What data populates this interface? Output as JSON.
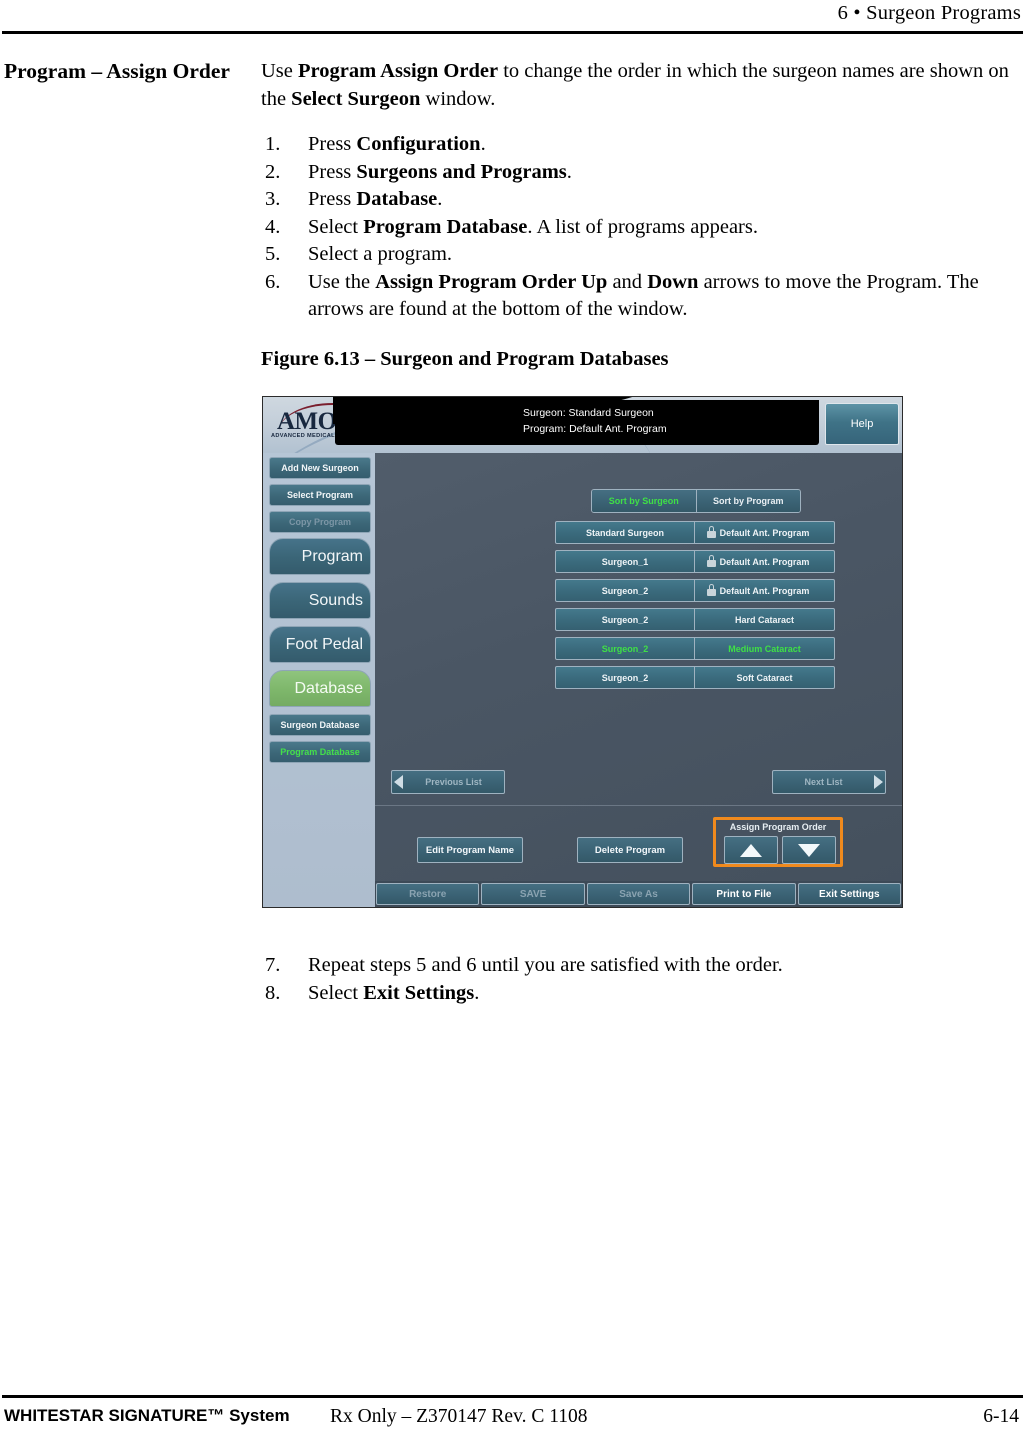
{
  "page_header": {
    "chapter": "6",
    "bullet": "•",
    "title": "Surgeon Programs",
    "full": "6  • Surgeon Programs"
  },
  "section": {
    "title": "Program – Assign Order"
  },
  "intro": {
    "part1": "Use ",
    "bold1": "Program Assign Order",
    "part2": " to change the order in which the surgeon names are shown on the ",
    "bold2": "Select Surgeon",
    "part3": " window."
  },
  "steps_before": [
    {
      "num": "1.",
      "pre": "Press ",
      "bold": "Configuration",
      "post": "."
    },
    {
      "num": "2.",
      "pre": "Press ",
      "bold": "Surgeons and Programs",
      "post": "."
    },
    {
      "num": "3.",
      "pre": "Press ",
      "bold": "Database",
      "post": "."
    },
    {
      "num": "4.",
      "pre": "Select ",
      "bold": "Program Database",
      "post": ". A list of programs appears."
    },
    {
      "num": "5.",
      "pre": "Select a program.",
      "bold": "",
      "post": ""
    },
    {
      "num": "6.",
      "pre": "Use the ",
      "bold": "Assign Program Order Up",
      "post": " and ",
      "bold2": "Down",
      "post2": " arrows to move the Program. The arrows are found at the bottom of the window."
    }
  ],
  "figure": {
    "caption": "Figure 6.13 – Surgeon and Program Databases",
    "logo": {
      "name": "AMO",
      "tagline": "ADVANCED MEDICAL OPTICS",
      "tm": "®"
    },
    "status": {
      "surgeon_line": "Surgeon:  Standard Surgeon",
      "program_line": "Program:  Default Ant. Program"
    },
    "help_label": "Help",
    "sidebar": [
      {
        "label": "Add New Surgeon",
        "state": "normal",
        "style": "small"
      },
      {
        "label": "Select Program",
        "state": "normal",
        "style": "small"
      },
      {
        "label": "Copy Program",
        "state": "disabled",
        "style": "small"
      },
      {
        "label": "Program",
        "state": "normal",
        "style": "big"
      },
      {
        "label": "Sounds",
        "state": "normal",
        "style": "big"
      },
      {
        "label": "Foot Pedal",
        "state": "normal",
        "style": "big"
      },
      {
        "label": "Database",
        "state": "active",
        "style": "big"
      },
      {
        "label": "Surgeon Database",
        "state": "normal",
        "style": "small"
      },
      {
        "label": "Program Database",
        "state": "selected",
        "style": "small"
      }
    ],
    "sort_tabs": [
      {
        "label": "Sort by Surgeon",
        "active": true
      },
      {
        "label": "Sort by Program",
        "active": false
      }
    ],
    "rows": [
      {
        "surgeon": "Standard Surgeon",
        "program": "Default Ant. Program",
        "locked": true,
        "selected": false
      },
      {
        "surgeon": "Surgeon_1",
        "program": "Default Ant. Program",
        "locked": true,
        "selected": false
      },
      {
        "surgeon": "Surgeon_2",
        "program": "Default Ant. Program",
        "locked": true,
        "selected": false
      },
      {
        "surgeon": "Surgeon_2",
        "program": "Hard Cataract",
        "locked": false,
        "selected": false
      },
      {
        "surgeon": "Surgeon_2",
        "program": "Medium Cataract",
        "locked": false,
        "selected": true
      },
      {
        "surgeon": "Surgeon_2",
        "program": "Soft Cataract",
        "locked": false,
        "selected": false
      }
    ],
    "nav": {
      "previous": "Previous List",
      "next": "Next List"
    },
    "actions": {
      "edit": "Edit Program Name",
      "delete": "Delete Program",
      "assign_order_caption": "Assign Program Order"
    },
    "toolbar": [
      {
        "label": "Restore",
        "enabled": false
      },
      {
        "label": "SAVE",
        "enabled": false
      },
      {
        "label": "Save As",
        "enabled": false
      },
      {
        "label": "Print to File",
        "enabled": true
      },
      {
        "label": "Exit Settings",
        "enabled": true
      }
    ],
    "colors": {
      "highlight_box": "#f08a1d",
      "selected_text": "#3fe046",
      "active_sidebar": "#7fb86c",
      "button_teal": "#3a6173",
      "panel_bg": "#4a5664",
      "sidebar_bg": "#b6c6d6"
    }
  },
  "steps_after": [
    {
      "num": "7.",
      "pre": "Repeat steps 5 and 6 until you are satisfied with the order.",
      "bold": "",
      "post": ""
    },
    {
      "num": "8.",
      "pre": "Select ",
      "bold": "Exit Settings",
      "post": "."
    }
  ],
  "footer": {
    "left": "WHITESTAR SIGNATURE™ System",
    "middle": "Rx Only – Z370147 Rev. C 1108",
    "right": "6-14"
  }
}
